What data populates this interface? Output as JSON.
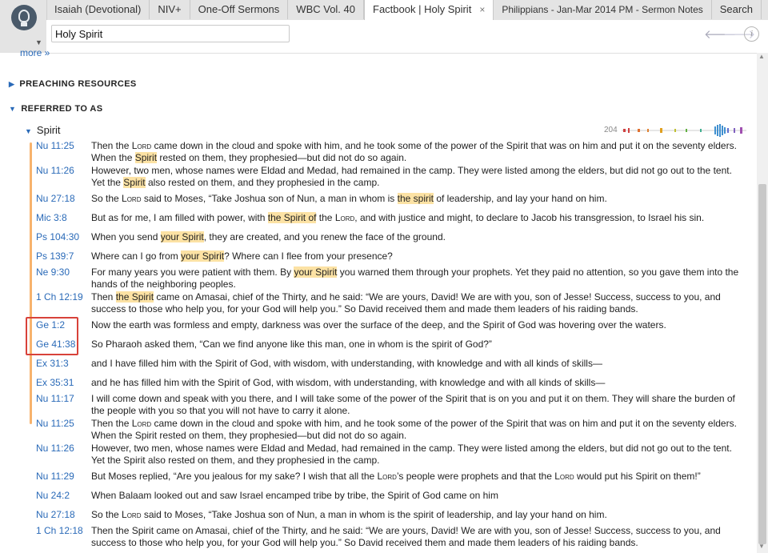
{
  "tabs": [
    {
      "label": "Isaiah (Devotional)"
    },
    {
      "label": "NIV+"
    },
    {
      "label": "One-Off Sermons"
    },
    {
      "label": "WBC Vol. 40"
    },
    {
      "label": "Factbook | Holy Spirit",
      "close": "×"
    },
    {
      "label": "Philippians - Jan-Mar 2014 PM - Sermon Notes"
    },
    {
      "label": "Search"
    },
    {
      "label": "+"
    }
  ],
  "search": {
    "value": "Holy Spirit"
  },
  "nav": {
    "info": "i"
  },
  "more_link": "more »",
  "sections": {
    "preaching": "PREACHING RESOURCES",
    "referred": "REFERRED TO AS",
    "spirit": "Spirit",
    "count": "204"
  },
  "rows": [
    {
      "ref": "Nu 11:25",
      "parts": [
        [
          "Then the ",
          ""
        ],
        [
          "Lord",
          "sc"
        ],
        [
          " came down in the cloud and spoke with him, and he took some of the power of the Spirit that was on him and put it on the seventy elders. When the ",
          ""
        ],
        [
          "Spirit",
          "hl"
        ],
        [
          " rested on them, they prophesied—but did not do so again.",
          ""
        ]
      ]
    },
    {
      "ref": "Nu 11:26",
      "parts": [
        [
          "However, two men, whose names were Eldad and Medad, had remained in the camp. They were listed among the elders, but did not go out to the tent. Yet the ",
          ""
        ],
        [
          "Spirit",
          "hl"
        ],
        [
          " also rested on them, and they prophesied in the camp.",
          ""
        ]
      ]
    },
    {
      "ref": "Nu 27:18",
      "parts": [
        [
          "So the ",
          ""
        ],
        [
          "Lord",
          "sc"
        ],
        [
          " said to Moses, “Take Joshua son of Nun, a man in whom is ",
          ""
        ],
        [
          "the spirit",
          "hl"
        ],
        [
          " of leadership, and lay your hand on him.",
          ""
        ]
      ]
    },
    {
      "ref": "Mic 3:8",
      "parts": [
        [
          "But as for me, I am filled with power, with ",
          ""
        ],
        [
          "the Spirit of",
          "hl"
        ],
        [
          " the ",
          ""
        ],
        [
          "Lord",
          "sc"
        ],
        [
          ", and with justice and might, to declare to Jacob his transgression, to Israel his sin.",
          ""
        ]
      ]
    },
    {
      "ref": "Ps 104:30",
      "parts": [
        [
          "When you send ",
          ""
        ],
        [
          "your Spirit",
          "hl"
        ],
        [
          ", they are created, and you renew the face of the ground.",
          ""
        ]
      ]
    },
    {
      "ref": "Ps 139:7",
      "parts": [
        [
          "Where can I go from ",
          ""
        ],
        [
          "your Spirit",
          "hl"
        ],
        [
          "? Where can I flee from your presence?",
          ""
        ]
      ]
    },
    {
      "ref": "Ne 9:30",
      "parts": [
        [
          "For many years you were patient with them. By ",
          ""
        ],
        [
          "your Spirit",
          "hl"
        ],
        [
          " you warned them through your prophets. Yet they paid no attention, so you gave them into the hands of the neighboring peoples.",
          ""
        ]
      ]
    },
    {
      "ref": "1 Ch 12:19",
      "parts": [
        [
          "Then ",
          ""
        ],
        [
          "the Spirit",
          "hl"
        ],
        [
          " came on Amasai, chief of the Thirty, and he said: “We are yours, David! We are with you, son of Jesse! Success, success to you, and success to those who help you, for your God will help you.” So David received them and made them leaders of his raiding bands.",
          ""
        ]
      ]
    },
    {
      "ref": "Ge 1:2",
      "parts": [
        [
          "Now the earth was formless and empty, darkness was over the surface of the deep, and the Spirit of God was hovering over the waters.",
          ""
        ]
      ]
    },
    {
      "ref": "Ge 41:38",
      "parts": [
        [
          "So Pharaoh asked them, “Can we find anyone like this man, one in whom is the spirit of God?”",
          ""
        ]
      ]
    },
    {
      "ref": "Ex 31:3",
      "parts": [
        [
          "and I have filled him with the Spirit of God, with wisdom, with understanding, with knowledge and with all kinds of skills—",
          ""
        ]
      ]
    },
    {
      "ref": "Ex 35:31",
      "parts": [
        [
          "and he has filled him with the Spirit of God, with wisdom, with understanding, with knowledge and with all kinds of skills—",
          ""
        ]
      ]
    },
    {
      "ref": "Nu 11:17",
      "parts": [
        [
          "I will come down and speak with you there, and I will take some of the power of the Spirit that is on you and put it on them. They will share the burden of the people with you so that you will not have to carry it alone.",
          ""
        ]
      ]
    },
    {
      "ref": "Nu 11:25",
      "parts": [
        [
          "Then the ",
          ""
        ],
        [
          "Lord",
          "sc"
        ],
        [
          " came down in the cloud and spoke with him, and he took some of the power of the Spirit that was on him and put it on the seventy elders. When the Spirit rested on them, they prophesied—but did not do so again.",
          ""
        ]
      ]
    },
    {
      "ref": "Nu 11:26",
      "parts": [
        [
          "However, two men, whose names were Eldad and Medad, had remained in the camp. They were listed among the elders, but did not go out to the tent. Yet the Spirit also rested on them, and they prophesied in the camp.",
          ""
        ]
      ]
    },
    {
      "ref": "Nu 11:29",
      "parts": [
        [
          "But Moses replied, “Are you jealous for my sake? I wish that all the ",
          ""
        ],
        [
          "Lord",
          "sc"
        ],
        [
          "’s people were prophets and that the ",
          ""
        ],
        [
          "Lord",
          "sc"
        ],
        [
          " would put his Spirit on them!”",
          ""
        ]
      ]
    },
    {
      "ref": "Nu 24:2",
      "parts": [
        [
          "When Balaam looked out and saw Israel encamped tribe by tribe, the Spirit of God came on him",
          ""
        ]
      ]
    },
    {
      "ref": "Nu 27:18",
      "parts": [
        [
          "So the ",
          ""
        ],
        [
          "Lord",
          "sc"
        ],
        [
          " said to Moses, “Take Joshua son of Nun, a man in whom is the spirit of leadership, and lay your hand on him.",
          ""
        ]
      ]
    },
    {
      "ref": "1 Ch 12:18",
      "parts": [
        [
          "Then the Spirit came on Amasai, chief of the Thirty, and he said: “We are yours, David! We are with you, son of Jesse! Success, success to you, and success to those who help you, for your God will help you.” So David received them and made them leaders of his raiding bands.",
          ""
        ]
      ]
    }
  ]
}
